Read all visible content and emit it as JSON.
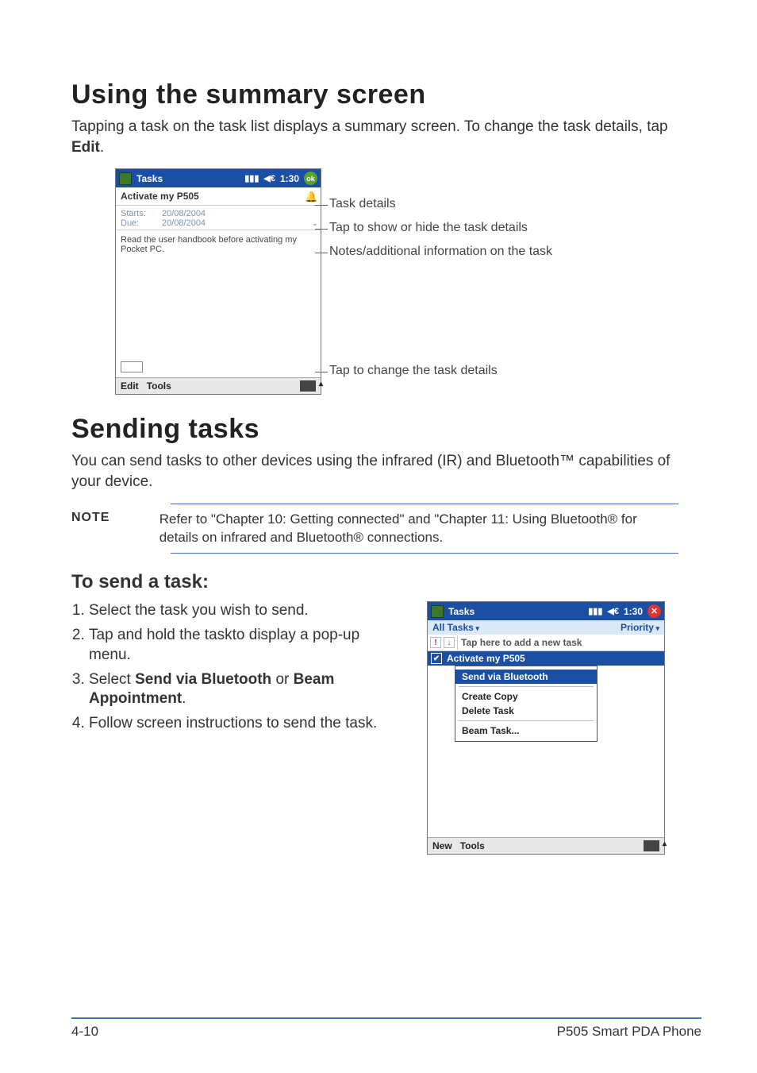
{
  "sections": {
    "summary": {
      "heading": "Using the summary screen",
      "intro_pre": "Tapping a task on the task list displays a summary screen. To change the task details, tap ",
      "intro_bold": "Edit",
      "intro_post": "."
    },
    "sending": {
      "heading": "Sending tasks",
      "intro": "You can send tasks to other devices using the infrared (IR) and Bluetooth™ capabilities of your device."
    },
    "send_task": {
      "heading": "To send a task:"
    }
  },
  "pdaA": {
    "title": "Tasks",
    "clock": "1:30",
    "ok": "ok",
    "task_title": "Activate my P505",
    "bell_alt": "reminder",
    "starts_label": "Starts:",
    "starts_value": "20/08/2004",
    "due_label": "Due:",
    "due_value": "20/08/2004",
    "expand_glyph": "⌄",
    "notes": "Read the user handbook before activating my Pocket PC.",
    "menu_edit": "Edit",
    "menu_tools": "Tools"
  },
  "calloutsA": {
    "c1": "Task details",
    "c2": "Tap to show or hide the task details",
    "c3": "Notes/additional information on the task",
    "c4": "Tap to change the task details"
  },
  "note": {
    "label": "NOTE",
    "text": "Refer to \"Chapter 10: Getting connected\" and \"Chapter 11: Using Bluetooth® for details on infrared and Bluetooth® connections."
  },
  "steps": {
    "s1": "Select the task you wish to send.",
    "s2": "Tap and hold the taskto display a pop-up menu.",
    "s3_pre": "Select ",
    "s3_b1": "Send via Bluetooth",
    "s3_mid": " or ",
    "s3_b2": "Beam Appointment",
    "s3_post": ".",
    "s4": "Follow screen instructions to send the task."
  },
  "pdaB": {
    "title": "Tasks",
    "clock": "1:30",
    "filter_all": "All Tasks",
    "filter_priority": "Priority",
    "pri_mark": "!",
    "due_mark": "↓",
    "add_hint": "Tap here to add a new task",
    "sel_task": "Activate my P505",
    "check": "✔",
    "menu": {
      "send_bt": "Send via Bluetooth",
      "copy": "Create Copy",
      "delete": "Delete Task",
      "beam": "Beam Task..."
    },
    "menu_new": "New",
    "menu_tools": "Tools"
  },
  "footer": {
    "left": "4-10",
    "right": "P505 Smart PDA Phone"
  }
}
